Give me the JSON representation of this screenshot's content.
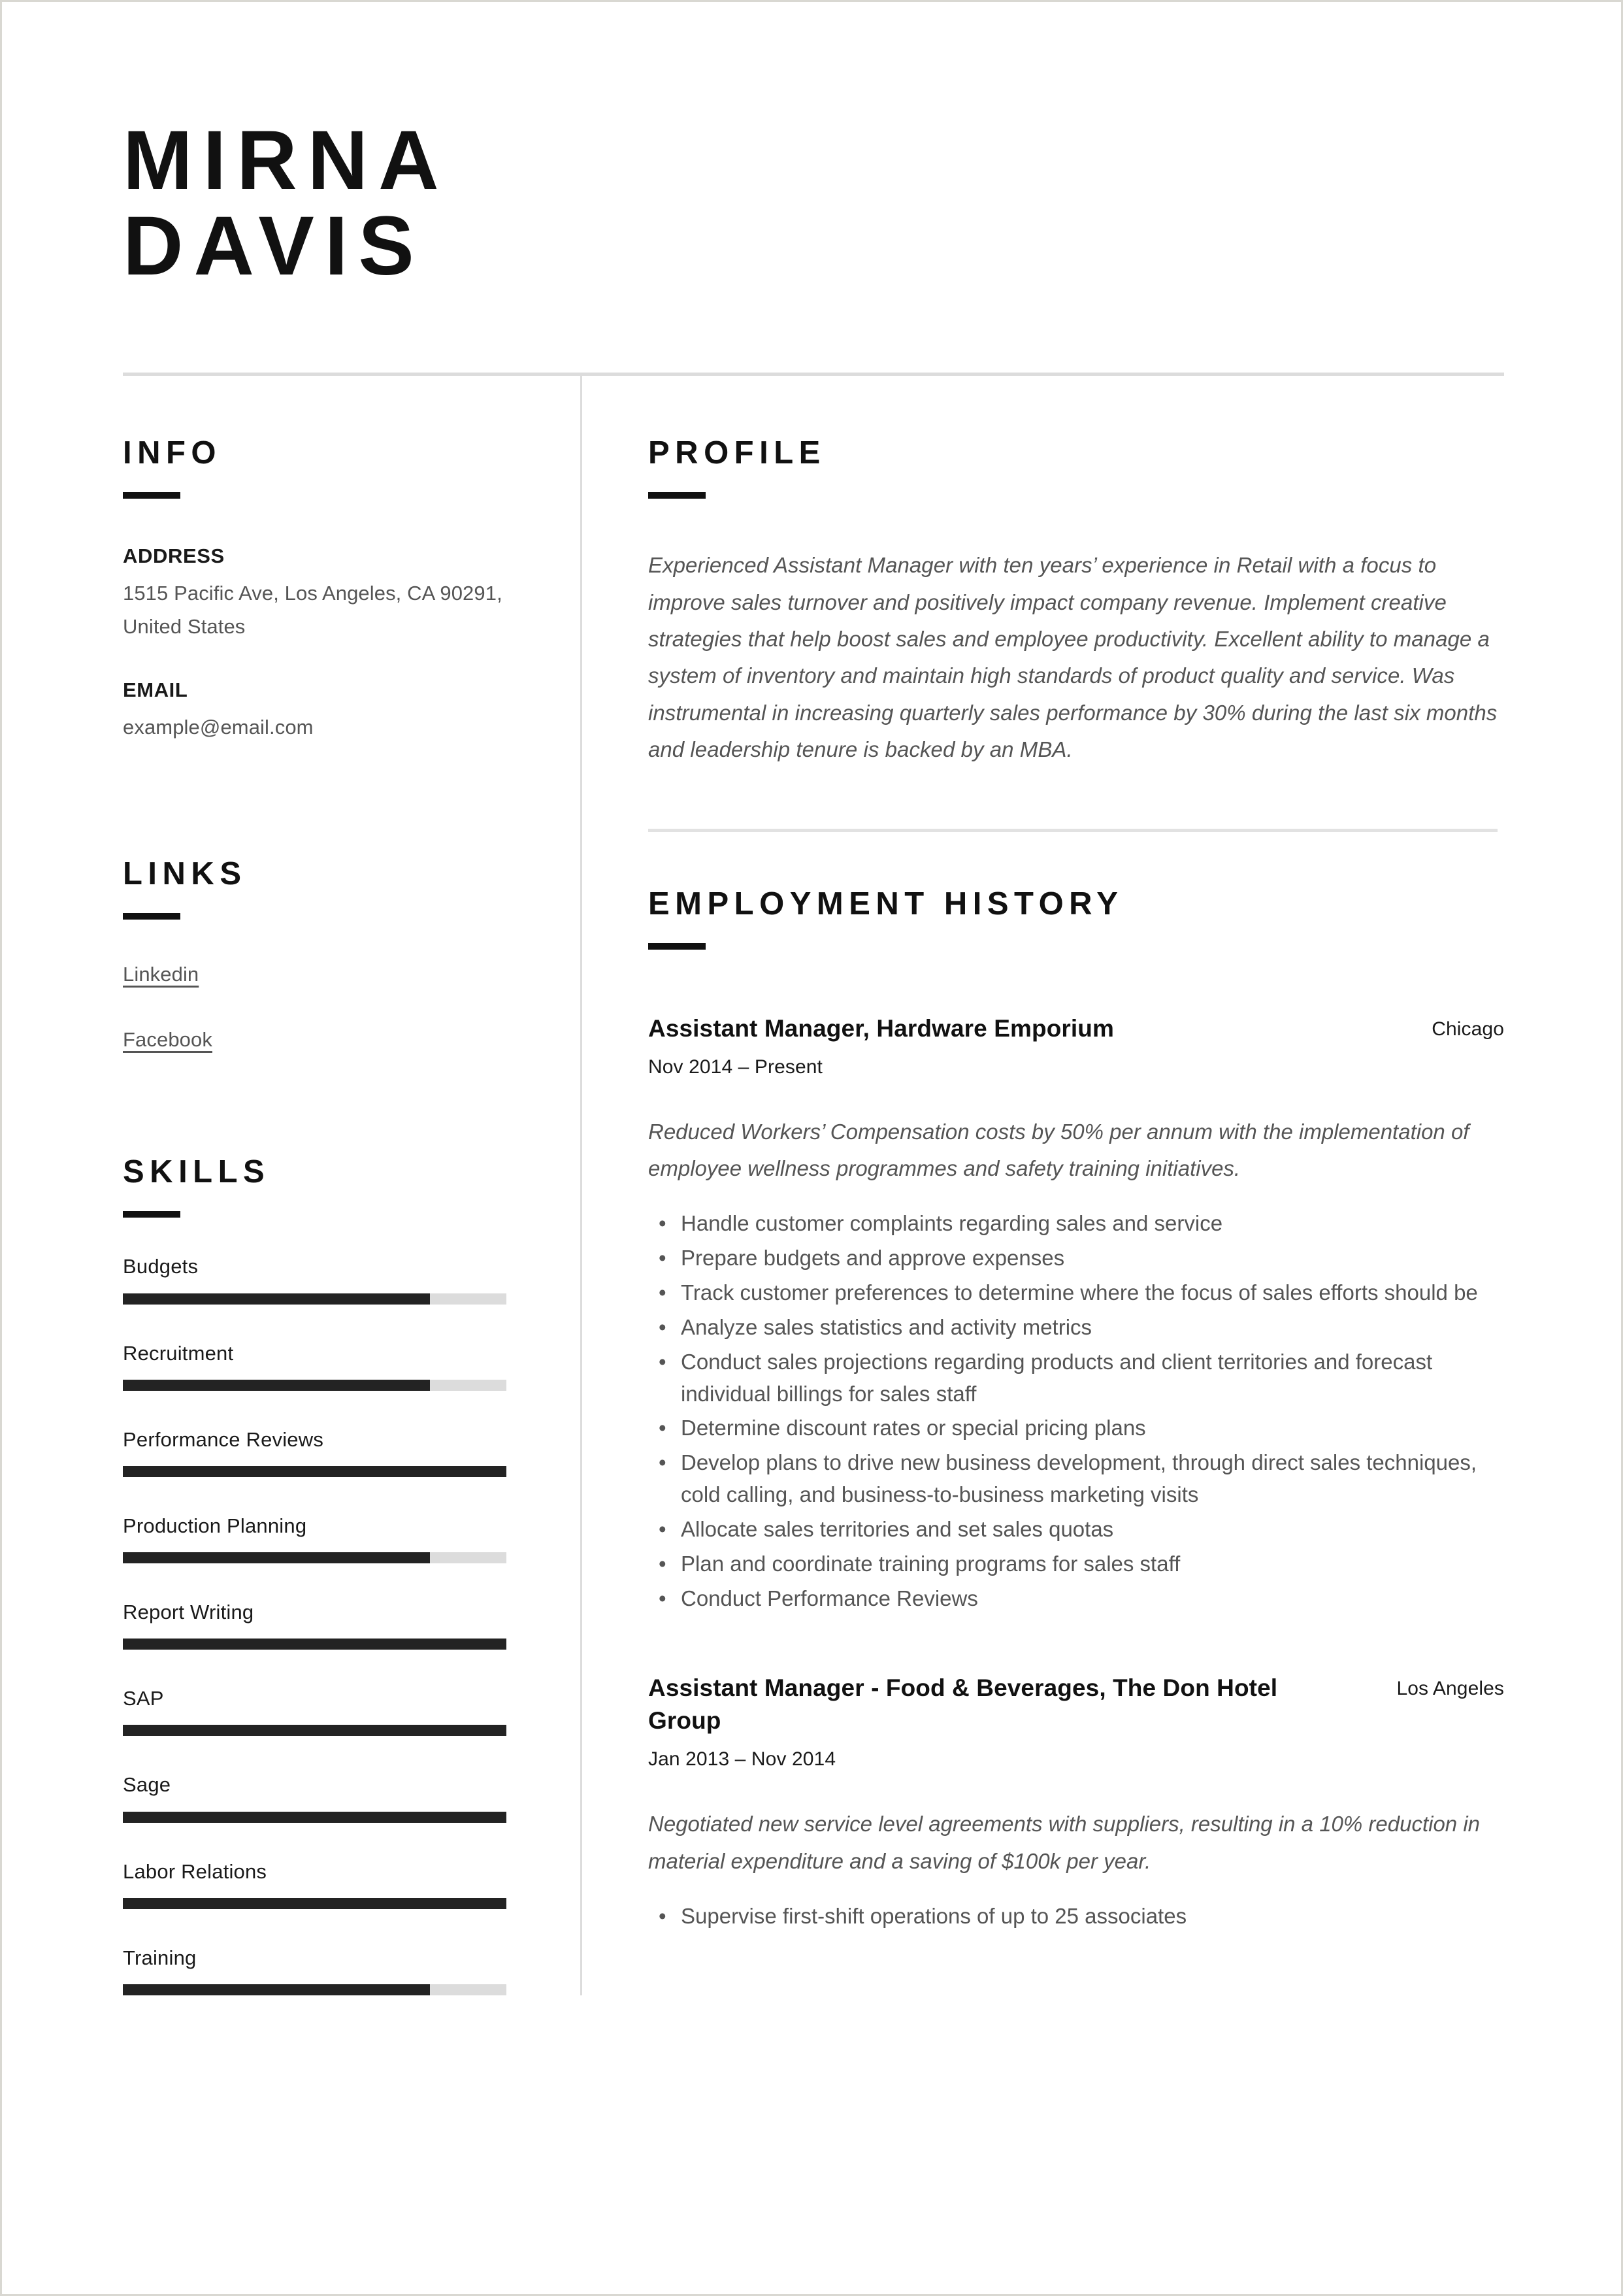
{
  "document": {
    "type": "resume",
    "name_line1": "MIRNA",
    "name_line2": "DAVIS"
  },
  "sidebar": {
    "info": {
      "heading": "INFO",
      "address_label": "ADDRESS",
      "address_value": "1515 Pacific Ave, Los Angeles, CA 90291, United States",
      "email_label": "EMAIL",
      "email_value": "example@email.com"
    },
    "links": {
      "heading": "LINKS",
      "items": [
        {
          "label": "Linkedin"
        },
        {
          "label": "Facebook"
        }
      ]
    },
    "skills": {
      "heading": "SKILLS",
      "items": [
        {
          "name": "Budgets",
          "level": 80
        },
        {
          "name": "Recruitment",
          "level": 80
        },
        {
          "name": "Performance Reviews",
          "level": 100
        },
        {
          "name": "Production Planning",
          "level": 80
        },
        {
          "name": "Report Writing",
          "level": 100
        },
        {
          "name": "SAP",
          "level": 100
        },
        {
          "name": "Sage",
          "level": 100
        },
        {
          "name": "Labor Relations",
          "level": 100
        },
        {
          "name": "Training",
          "level": 80
        }
      ]
    }
  },
  "main": {
    "profile": {
      "heading": "PROFILE",
      "text": "Experienced Assistant Manager with ten years’ experience in Retail with a focus to improve sales turnover and positively impact company revenue. Implement creative strategies that help boost sales and employee productivity. Excellent ability to manage a system of inventory and maintain high standards of product quality and service. Was instrumental in increasing quarterly sales performance by 30% during the last six months and leadership tenure is backed by an MBA."
    },
    "employment": {
      "heading": "EMPLOYMENT HISTORY",
      "jobs": [
        {
          "title": "Assistant Manager, Hardware Emporium",
          "location": "Chicago",
          "dates": "Nov 2014 – Present",
          "summary": "Reduced Workers’ Compensation costs by 50% per annum with the implementation of employee wellness programmes and safety training initiatives.",
          "bullets": [
            "Handle customer complaints regarding sales and service",
            "Prepare budgets and approve expenses",
            "Track customer preferences to determine where the focus of sales efforts should be",
            "Analyze sales statistics and activity metrics",
            "Conduct sales projections regarding products and client territories and forecast individual billings for sales staff",
            "Determine discount rates or special pricing plans",
            "Develop plans to drive new business development, through direct sales techniques, cold calling, and business-to-business marketing visits",
            "Allocate sales territories and set sales quotas",
            "Plan and coordinate training programs for sales staff",
            "Conduct Performance Reviews"
          ]
        },
        {
          "title": "Assistant Manager - Food & Beverages, The Don Hotel Group",
          "location": "Los Angeles",
          "dates": "Jan 2013 – Nov 2014",
          "summary": "Negotiated new service level agreements with suppliers, resulting in a 10% reduction in material expenditure and a saving of $100k per year.",
          "bullets": [
            "Supervise first-shift operations of up to 25 associates"
          ]
        }
      ]
    }
  },
  "colors": {
    "text_dark": "#111111",
    "text_body": "#555555",
    "rule": "#dcdcdc",
    "skill_fill": "#232323",
    "skill_track": "#dcdcdc",
    "page_border": "#d9d8d2"
  }
}
